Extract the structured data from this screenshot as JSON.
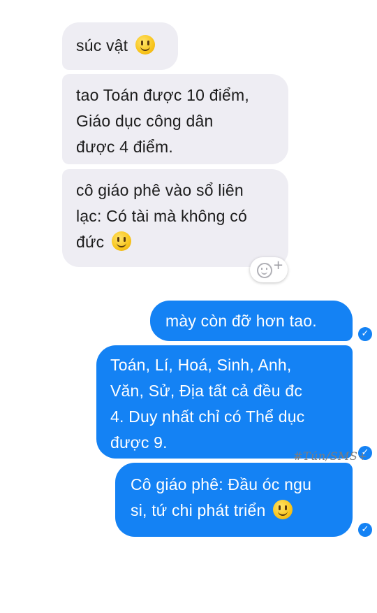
{
  "conversation": {
    "incoming": [
      {
        "lines": [
          "súc vật"
        ],
        "emoji": "slightly-smiling-face"
      },
      {
        "lines": [
          "tao Toán được 10 điểm,",
          "Giáo dục công dân",
          "được 4 điểm."
        ]
      },
      {
        "lines": [
          "cô giáo phê vào sổ liên",
          "lạc: Có tài mà không có",
          "đức"
        ],
        "emoji": "slightly-smiling-face"
      }
    ],
    "outgoing": [
      {
        "lines": [
          "mày còn đỡ hơn tao."
        ]
      },
      {
        "lines": [
          "Toán, Lí, Hoá, Sinh, Anh,",
          "Văn, Sử, Địa tất cả đều đc",
          "4. Duy nhất chỉ có Thể dục",
          "được 9."
        ]
      },
      {
        "lines": [
          "Cô giáo phê: Đầu óc ngu",
          "si, tứ chi phát triển"
        ],
        "emoji": "slightly-smiling-face"
      }
    ]
  },
  "reaction_button": {
    "icon": "add-reaction-icon",
    "plus": "+"
  },
  "watermark": "#Tún/SMS+",
  "colors": {
    "incoming_bg": "#eeedf3",
    "outgoing_bg": "#1482f4",
    "outgoing_text": "#ffffff"
  }
}
